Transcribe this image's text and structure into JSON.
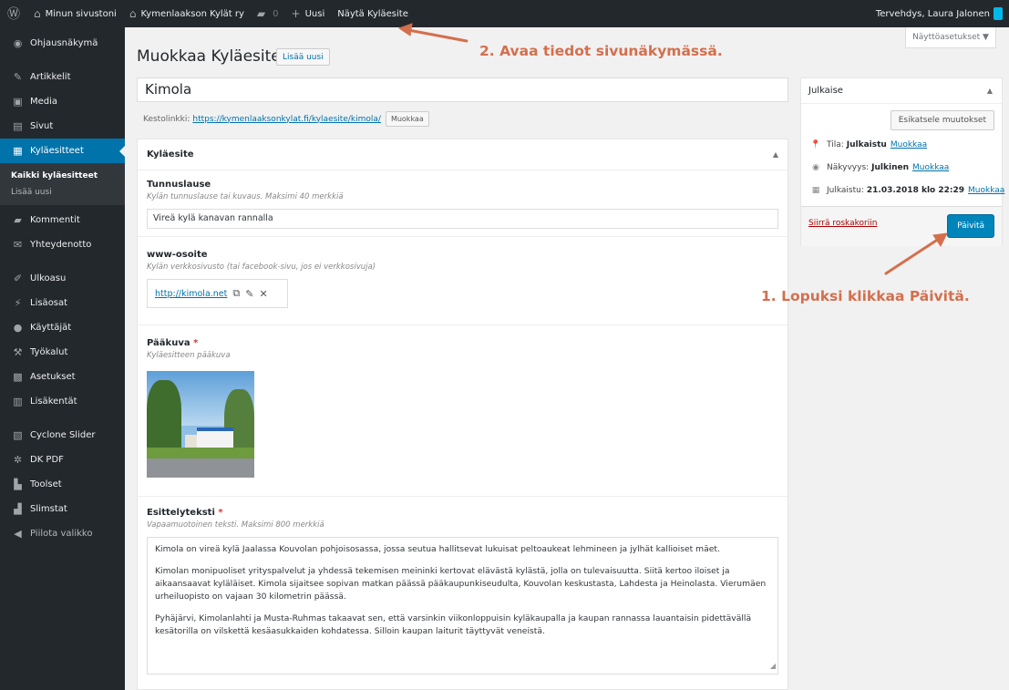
{
  "adminbar": {
    "site_name": "Minun sivustoni",
    "site_link": "Kymenlaakson Kylät ry",
    "comments_count": "0",
    "new_label": "Uusi",
    "view_label": "Näytä Kyläesite",
    "greeting": "Tervehdys, Laura Jalonen"
  },
  "sidebar": {
    "items": [
      {
        "icon": "dashboard-icon",
        "label": "Ohjausnäkymä"
      },
      {
        "icon": "pushpin-icon",
        "label": "Artikkelit"
      },
      {
        "icon": "media-icon",
        "label": "Media"
      },
      {
        "icon": "page-icon",
        "label": "Sivut"
      },
      {
        "icon": "document-icon",
        "label": "Kyläesitteet"
      },
      {
        "icon": "comment-icon",
        "label": "Kommentit"
      },
      {
        "icon": "envelope-icon",
        "label": "Yhteydenotto"
      },
      {
        "icon": "paintbrush-icon",
        "label": "Ulkoasu"
      },
      {
        "icon": "plugin-icon",
        "label": "Lisäosat"
      },
      {
        "icon": "user-icon",
        "label": "Käyttäjät"
      },
      {
        "icon": "wrench-icon",
        "label": "Työkalut"
      },
      {
        "icon": "settings-icon",
        "label": "Asetukset"
      },
      {
        "icon": "table-icon",
        "label": "Lisäkentät"
      },
      {
        "icon": "slider-icon",
        "label": "Cyclone Slider"
      },
      {
        "icon": "gear-icon",
        "label": "DK PDF"
      },
      {
        "icon": "toolset-icon",
        "label": "Toolset"
      },
      {
        "icon": "chart-icon",
        "label": "Slimstat"
      },
      {
        "icon": "collapse-icon",
        "label": "Piilota valikko"
      }
    ],
    "submenu": [
      "Kaikki kyläesitteet",
      "Lisää uusi"
    ]
  },
  "screen_options": "Näyttöasetukset ▼",
  "page": {
    "title": "Muokkaa Kyläesite",
    "add_new": "Lisää uusi",
    "post_title": "Kimola",
    "permalink_label": "Kestolinkki:",
    "permalink_url": "https://kymenlaaksonkylat.fi/kylaesite/kimola/",
    "edit_slug": "Muokkaa"
  },
  "metabox": {
    "title": "Kyläesite",
    "fields": {
      "motto": {
        "label": "Tunnuslause",
        "desc": "Kylän tunnuslause tai kuvaus. Maksimi 40 merkkiä",
        "value": "Vireä kylä kanavan rannalla"
      },
      "website": {
        "label": "www-osoite",
        "desc": "Kylän verkkosivusto (tai facebook-sivu, jos ei verkkosivuja)",
        "value": "http://kimola.net"
      },
      "image": {
        "label": "Pääkuva",
        "required": "*",
        "desc": "Kyläesitteen pääkuva"
      },
      "intro": {
        "label": "Esittelyteksti",
        "required": "*",
        "desc": "Vapaamuotoinen teksti. Maksimi 800 merkkiä",
        "paragraphs": [
          "Kimola on vireä kylä Jaalassa Kouvolan pohjoisosassa, jossa seutua hallitsevat lukuisat peltoaukeat lehmineen ja jylhät kallioiset mäet.",
          "Kimolan monipuoliset yrityspalvelut ja yhdessä tekemisen meininki kertovat elävästä kylästä, jolla on tulevaisuutta. Siitä kertoo iloiset ja aikaansaavat kyläläiset. Kimola sijaitsee sopivan matkan päässä pääkaupunkiseudulta, Kouvolan keskustasta, Lahdesta ja Heinolasta. Vierumäen urheiluopisto on vajaan 30 kilometrin päässä.",
          "Pyhäjärvi, Kimolanlahti ja Musta-Ruhmas takaavat sen, että varsinkin viikonloppuisin kyläkaupalla ja kaupan rannassa lauantaisin pidettävällä kesätorilla on vilskettä kesäasukkaiden kohdatessa. Silloin kaupan laiturit täyttyvät veneistä."
        ]
      }
    }
  },
  "publish": {
    "title": "Julkaise",
    "preview": "Esikatsele muutokset",
    "status_label": "Tila:",
    "status_value": "Julkaistu",
    "visibility_label": "Näkyvyys:",
    "visibility_value": "Julkinen",
    "date_label": "Julkaistu:",
    "date_value": "21.03.2018 klo 22:29",
    "edit_link": "Muokkaa",
    "trash": "Siirrä roskakoriin",
    "update": "Päivitä"
  },
  "annotations": {
    "step2": "2. Avaa tiedot sivunäkymässä.",
    "step1": "1. Lopuksi klikkaa Päivitä.",
    "color": "#d46f4d"
  },
  "colors": {
    "admin_dark": "#23282d",
    "accent": "#0073aa",
    "button_primary": "#0085ba"
  }
}
